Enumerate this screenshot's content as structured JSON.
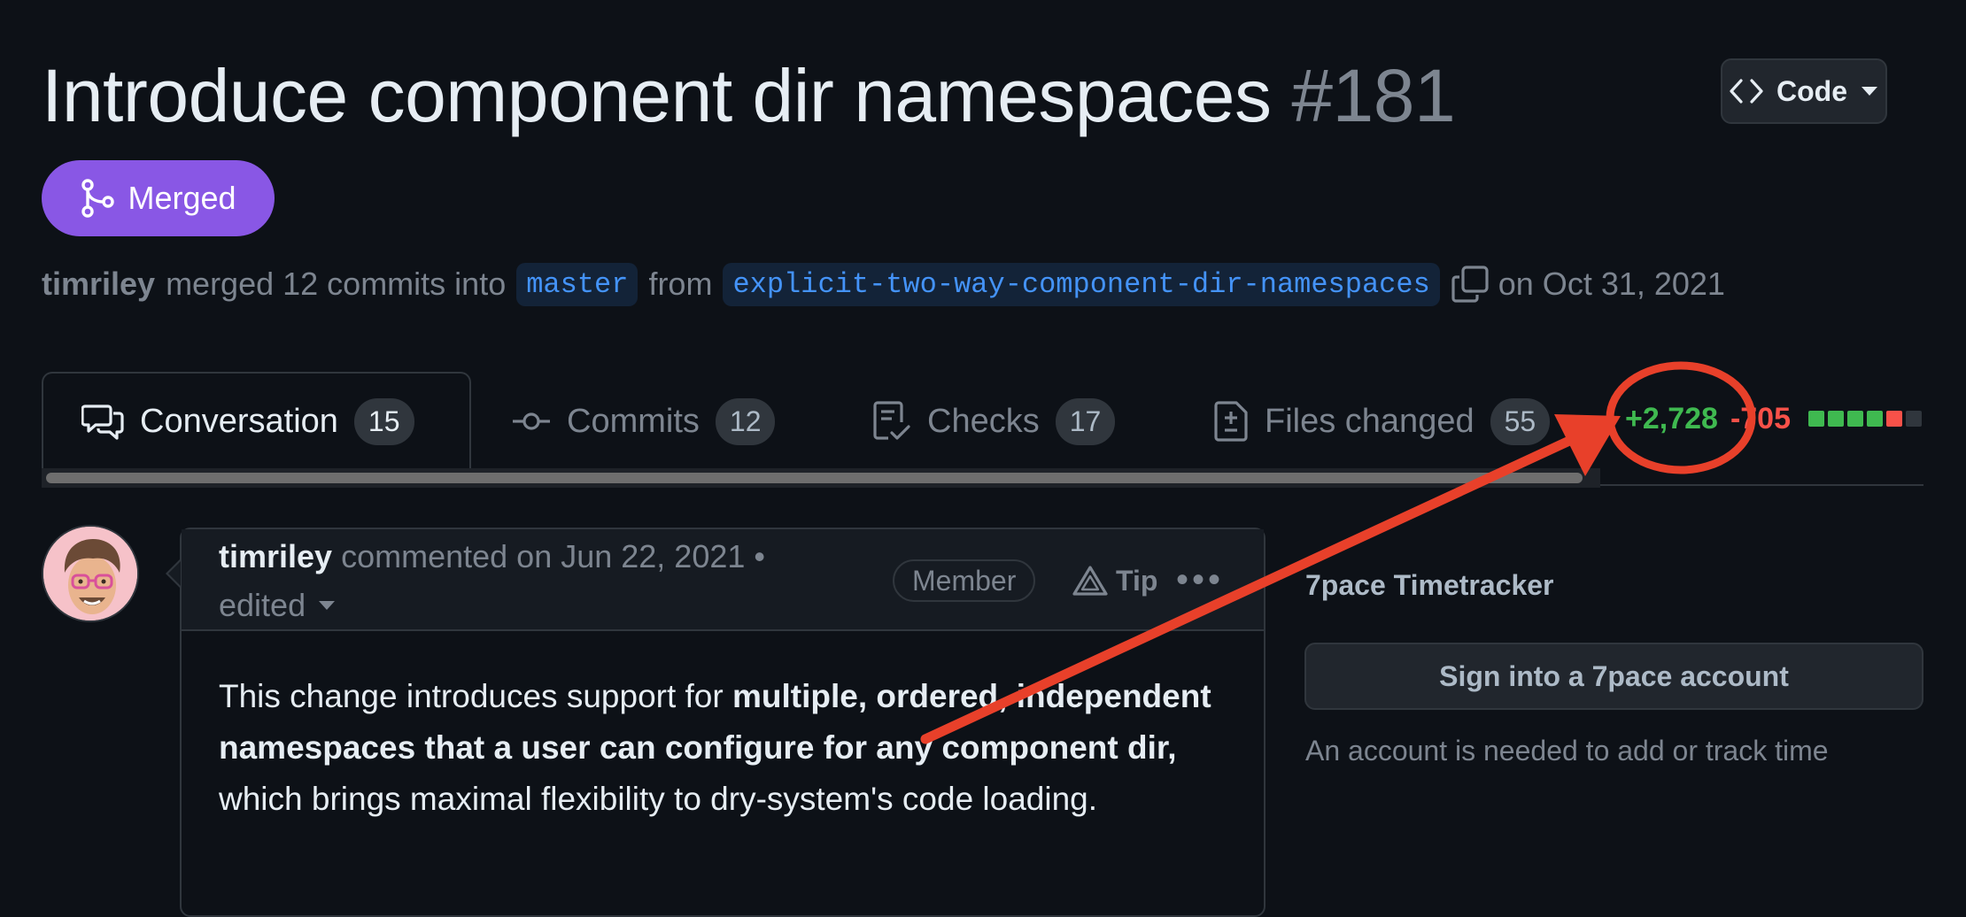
{
  "pr": {
    "title": "Introduce component dir namespaces",
    "number": "#181",
    "state": "Merged",
    "author": "timriley",
    "merged_text": "merged 12 commits into",
    "base_branch": "master",
    "from_text": "from",
    "head_branch": "explicit-two-way-component-dir-namespaces",
    "date_text": "on Oct 31, 2021"
  },
  "header": {
    "code_label": "Code"
  },
  "tabs": [
    {
      "label": "Conversation",
      "count": "15",
      "icon": "comment-discussion-icon",
      "active": true
    },
    {
      "label": "Commits",
      "count": "12",
      "icon": "git-commit-icon",
      "active": false
    },
    {
      "label": "Checks",
      "count": "17",
      "icon": "checklist-icon",
      "active": false
    },
    {
      "label": "Files changed",
      "count": "55",
      "icon": "file-diff-icon",
      "active": false
    }
  ],
  "diffstat": {
    "additions": "+2,728",
    "deletions": "-705",
    "blocks": [
      "#3fb950",
      "#3fb950",
      "#3fb950",
      "#3fb950",
      "#f85149",
      "#30363d"
    ]
  },
  "comment": {
    "author": "timriley",
    "meta": "commented on Jun 22, 2021 •",
    "edited": "edited",
    "badge": "Member",
    "tip": "Tip",
    "more": "•••",
    "body": {
      "p1": "This change introduces support for ",
      "bold1": "multiple, ordered, independent namespaces that a user can configure for any component dir,",
      "p2": " which brings maximal flexibility to dry-system's code loading."
    }
  },
  "sidebar": {
    "title": "7pace Timetracker",
    "button": "Sign into a 7pace account",
    "note": "An account is needed to add or track time"
  },
  "colors": {
    "merged_purple": "#8957e5",
    "annotation_red": "#e8402a",
    "additions_green": "#3fb950",
    "deletions_red": "#f85149"
  }
}
